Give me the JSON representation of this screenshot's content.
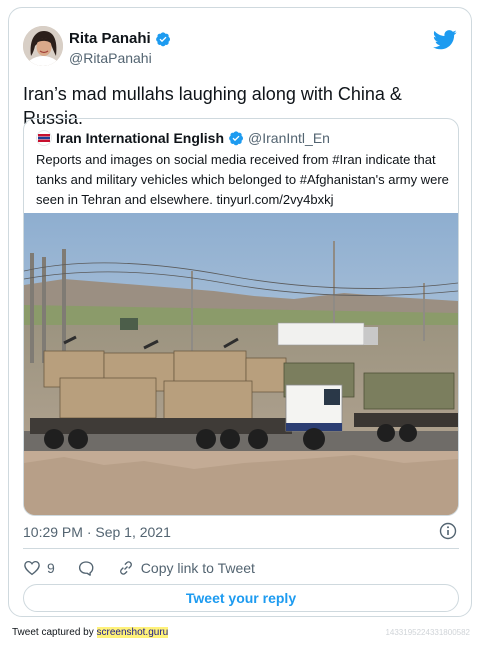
{
  "tweet": {
    "author_name": "Rita Panahi",
    "author_handle": "@RitaPanahi",
    "text": "Iran’s mad mullahs laughing along with China & Russia.",
    "timestamp": "10:29 PM · Sep 1, 2021",
    "likes": "9",
    "copy_link_label": "Copy link to Tweet",
    "reply_button_label": "Tweet your reply"
  },
  "quoted_tweet": {
    "author_name": "Iran International English",
    "author_handle": "@IranIntl_En",
    "text_line1": "Reports and images on social media received from #Iran indicate that",
    "text_line2": "tanks and military vehicles which belonged to #Afghanistan's army were",
    "text_line3": "seen in Tehran and elsewhere. tinyurl.com/2vy4bxkj"
  },
  "footer": {
    "prefix": "Tweet captured by ",
    "brand": "screenshot.guru",
    "id": "1433195224331800582"
  },
  "icons": {
    "verified": "verified-badge-icon",
    "twitter_logo": "twitter-bird-icon",
    "info": "info-icon",
    "like": "heart-icon",
    "reply": "speech-bubble-icon",
    "copy_link": "link-icon"
  },
  "colors": {
    "accent": "#1d9bf0",
    "secondary_text": "#536471",
    "border": "#cfd9de",
    "footer_highlight": "#fff27a"
  }
}
